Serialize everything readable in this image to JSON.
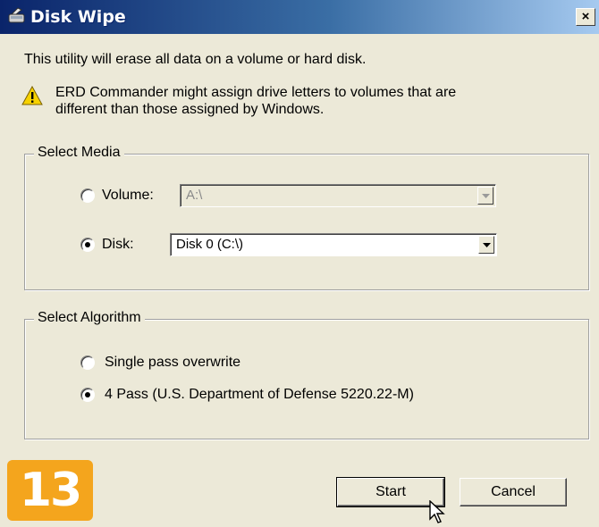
{
  "window": {
    "title": "Disk Wipe",
    "close_glyph": "×"
  },
  "intro_text": "This utility will erase all data on a volume or hard disk.",
  "warning": {
    "icon": "warning-icon",
    "line1": "ERD Commander might assign drive letters to volumes that are",
    "line2": "different than those assigned by Windows."
  },
  "select_media": {
    "legend": "Select Media",
    "volume_label": "Volume:",
    "volume_value": "A:\\",
    "volume_selected": false,
    "volume_enabled": false,
    "disk_label": "Disk:",
    "disk_value": "Disk 0 (C:\\)",
    "disk_selected": true
  },
  "select_algorithm": {
    "legend": "Select Algorithm",
    "options": [
      {
        "label": "Single pass overwrite",
        "selected": false
      },
      {
        "label": "4 Pass (U.S. Department of Defense 5220.22-M)",
        "selected": true
      }
    ]
  },
  "buttons": {
    "start": "Start",
    "cancel": "Cancel"
  },
  "step_badge": "13",
  "colors": {
    "title_start": "#0a246a",
    "title_end": "#a6caf0",
    "face": "#ece9d8",
    "badge": "#f4a51d",
    "warning_yellow": "#f7d200"
  }
}
